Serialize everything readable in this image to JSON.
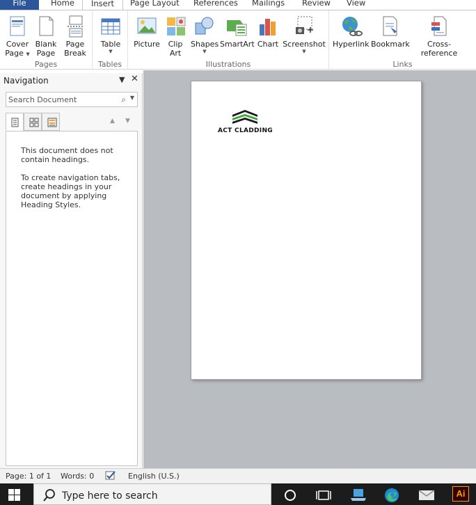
{
  "tabs": [
    {
      "label": "File"
    },
    {
      "label": "Home"
    },
    {
      "label": "Insert"
    },
    {
      "label": "Page Layout"
    },
    {
      "label": "References"
    },
    {
      "label": "Mailings"
    },
    {
      "label": "Review"
    },
    {
      "label": "View"
    }
  ],
  "ribbon": {
    "groups": {
      "pages": "Pages",
      "tables": "Tables",
      "illustrations": "Illustrations",
      "links": "Links"
    },
    "buttons": {
      "cover_page": [
        "Cover",
        "Page"
      ],
      "blank_page": [
        "Blank",
        "Page"
      ],
      "page_break": [
        "Page",
        "Break"
      ],
      "table": "Table",
      "picture": "Picture",
      "clip_art": [
        "Clip",
        "Art"
      ],
      "shapes": "Shapes",
      "smartart": "SmartArt",
      "chart": "Chart",
      "screenshot": "Screenshot",
      "hyperlink": "Hyperlink",
      "bookmark": "Bookmark",
      "cross_reference": "Cross-reference"
    }
  },
  "navigation": {
    "title": "Navigation",
    "search_placeholder": "Search Document",
    "message_1": [
      "This document does not",
      "contain headings."
    ],
    "message_2": [
      "To create navigation tabs,",
      "create headings in your",
      "document by applying",
      "Heading Styles."
    ]
  },
  "document": {
    "logo_text": "ACT CLADDING"
  },
  "status": {
    "page": "Page: 1 of 1",
    "words": "Words: 0",
    "language": "English (U.S.)"
  },
  "taskbar": {
    "search_placeholder": "Type here to search",
    "ai_label": "Ai"
  },
  "colors": {
    "file_tab": "#2b579a",
    "workspace": "#b9bcc0",
    "logo_green": "#3aa935",
    "taskbar": "#1c1c1c"
  }
}
